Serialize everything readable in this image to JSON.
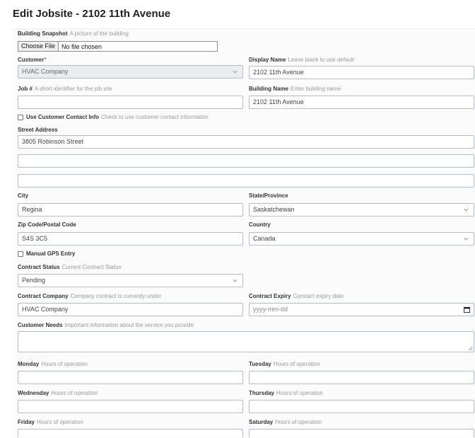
{
  "page": {
    "title": "Edit Jobsite - 2102 11th Avenue"
  },
  "snapshot": {
    "label": "Building Snapshot",
    "hint": "A picture of the building",
    "button": "Choose File",
    "status": "No file chosen"
  },
  "customer": {
    "label": "Customer",
    "required_mark": "*",
    "value": "HVAC Company"
  },
  "display_name": {
    "label": "Display Name",
    "hint": "Leave blank to use default",
    "value": "2102 11th Avenue"
  },
  "job_number": {
    "label": "Job #",
    "hint": "A short identifier for the job site",
    "value": ""
  },
  "building_name": {
    "label": "Building Name",
    "hint": "Enter building name",
    "value": "2102 11th Avenue"
  },
  "use_contact": {
    "label": "Use Customer Contact Info",
    "hint": "Check to use customer contact information",
    "checked": false
  },
  "street": {
    "label": "Street Address",
    "line1": "3805 Robinson Street",
    "line2": "",
    "line3": ""
  },
  "city": {
    "label": "City",
    "value": "Regina"
  },
  "state": {
    "label": "State/Province",
    "value": "Saskatchewan"
  },
  "zip": {
    "label": "Zip Code/Postal Code",
    "value": "S4S 3C5"
  },
  "country": {
    "label": "Country",
    "value": "Canada"
  },
  "manual_gps": {
    "label": "Manual GPS Entry",
    "checked": false
  },
  "contract_status": {
    "label": "Contract Status",
    "hint": "Current Contract Status",
    "value": "Pending"
  },
  "contract_company": {
    "label": "Contract Company",
    "hint": "Company contract is currently under",
    "value": "HVAC Company"
  },
  "contract_expiry": {
    "label": "Contract Expiry",
    "hint": "Contract expiry date",
    "placeholder": "yyyy-mm-dd"
  },
  "customer_needs": {
    "label": "Customer Needs",
    "hint": "Important information about the service you provide",
    "value": ""
  },
  "hours": {
    "hint": "Hours of operation",
    "monday": "Monday",
    "tuesday": "Tuesday",
    "wednesday": "Wednesday",
    "thursday": "Thursday",
    "friday": "Friday",
    "saturday": "Saturday"
  },
  "colors": {
    "border": "#b5bcc6",
    "disabled_bg": "#ebecee",
    "panel_bg": "#fbfbfc"
  }
}
